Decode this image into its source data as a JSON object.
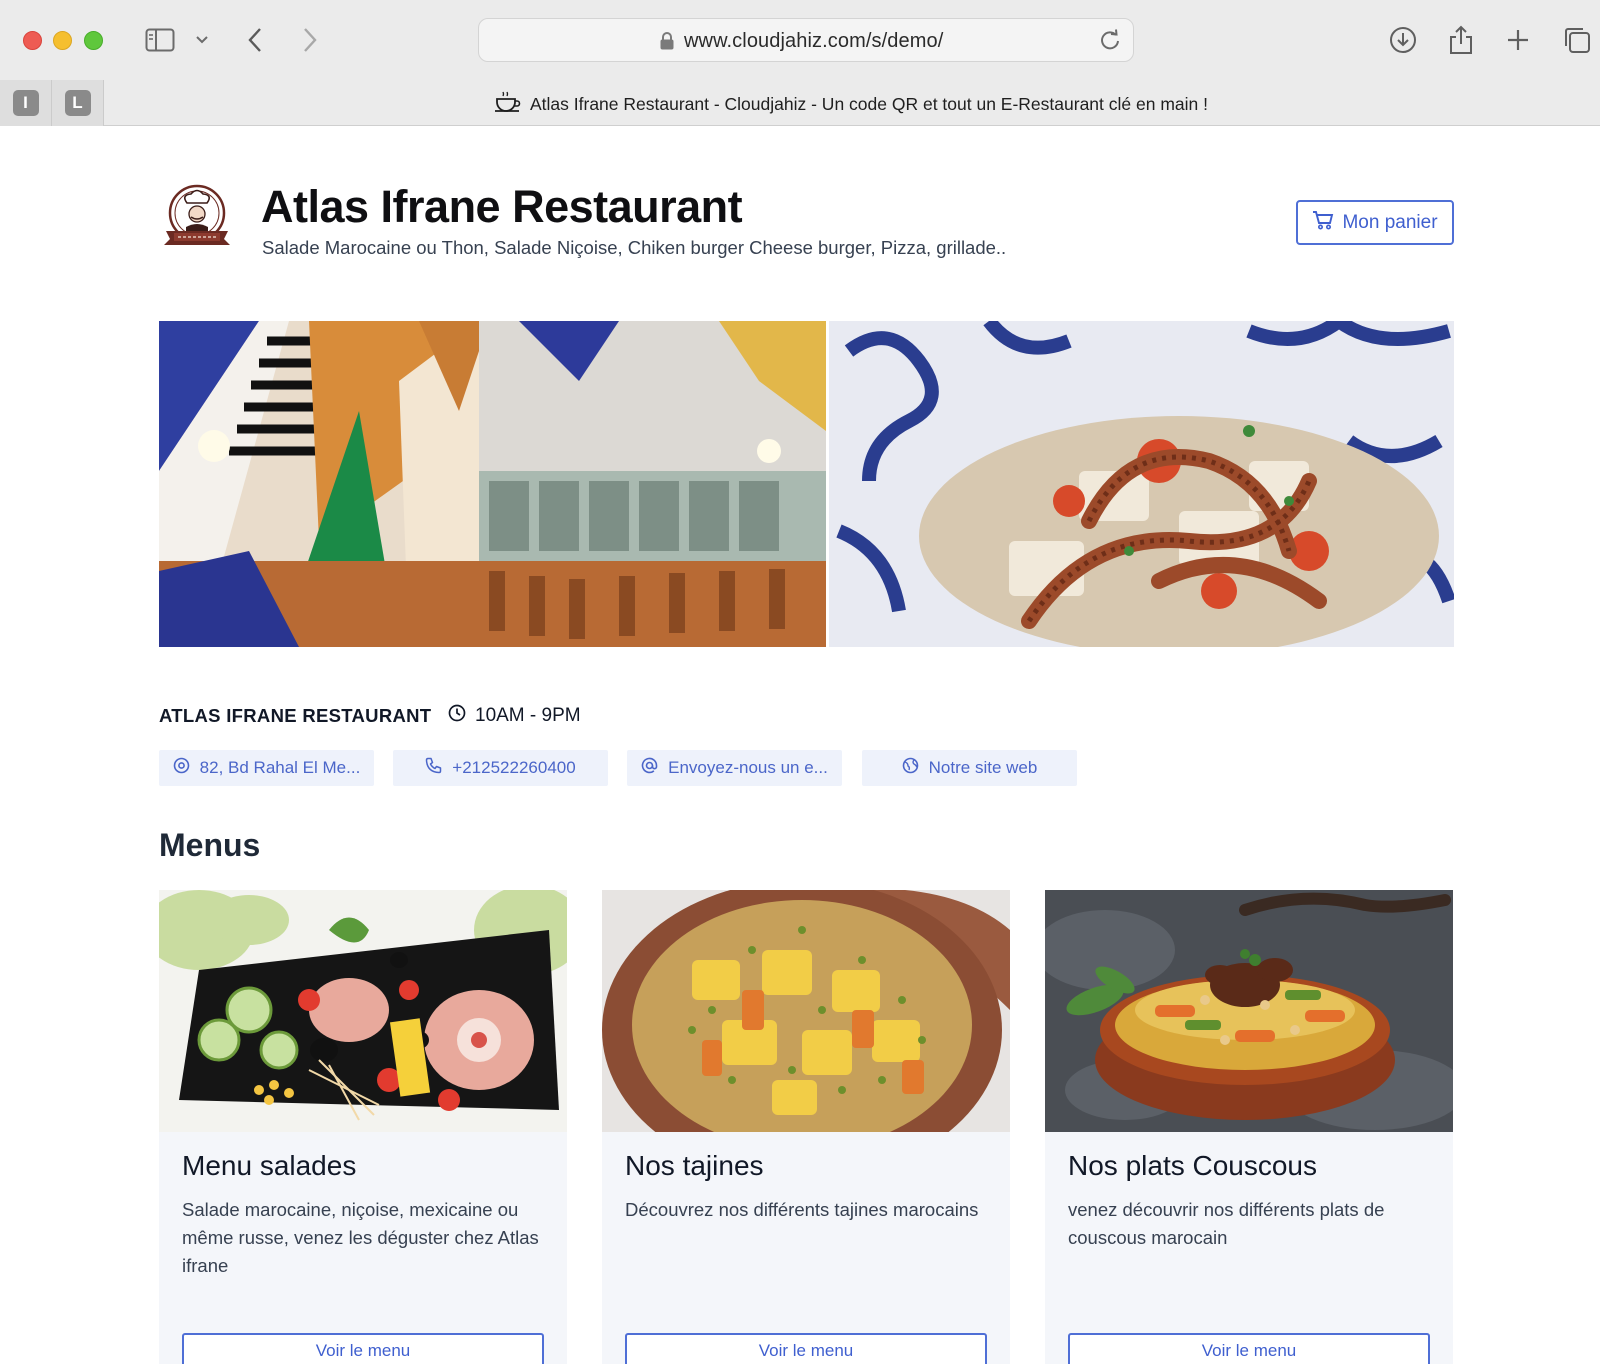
{
  "browser": {
    "url": "www.cloudjahiz.com/s/demo/",
    "tab_title": "Atlas Ifrane Restaurant - Cloudjahiz - Un code QR et tout un E-Restaurant clé en main !",
    "pinned_tabs": [
      "I",
      "L"
    ],
    "icons": [
      "sidebar-icon",
      "chevron-down-icon",
      "back-icon",
      "forward-icon",
      "lock-icon",
      "reload-icon",
      "download-icon",
      "share-icon",
      "plus-icon",
      "tabs-overview-icon",
      "coffee-cup-icon"
    ]
  },
  "header": {
    "title": "Atlas Ifrane Restaurant",
    "subtitle": "Salade Marocaine ou Thon, Salade Niçoise, Chiken burger Cheese burger, Pizza, grillade..",
    "cart_label": "Mon panier"
  },
  "info": {
    "name": "ATLAS IFRANE RESTAURANT",
    "hours": "10AM - 9PM",
    "chips": {
      "address": "82, Bd Rahal El Me...",
      "phone": "+212522260400",
      "email": "Envoyez-nous un e...",
      "website": "Notre site web"
    }
  },
  "menus": {
    "title": "Menus",
    "cards": [
      {
        "title": "Menu salades",
        "description": "Salade marocaine, niçoise, mexicaine ou même russe, venez les déguster chez Atlas ifrane",
        "button": "Voir le menu"
      },
      {
        "title": "Nos tajines",
        "description": "Découvrez nos différents tajines marocains",
        "button": "Voir le menu"
      },
      {
        "title": "Nos plats Couscous",
        "description": "venez découvrir nos différents plats de couscous marocain",
        "button": "Voir le menu"
      }
    ]
  },
  "colors": {
    "accent": "#4f6fd6",
    "chip_bg": "#eef2fb",
    "card_bg": "#f4f6fa"
  }
}
